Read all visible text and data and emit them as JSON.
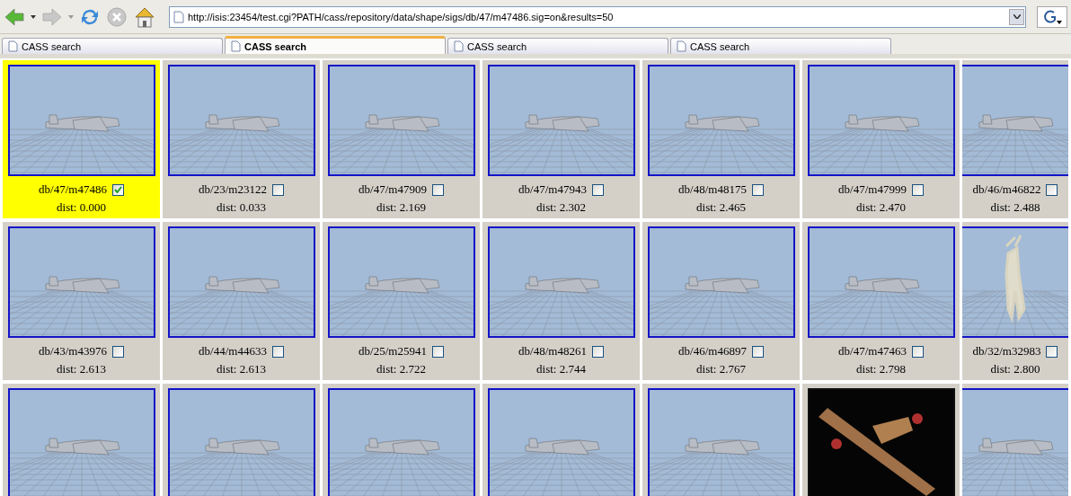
{
  "toolbar": {
    "url": "http://isis:23454/test.cgi?PATH/cass/repository/data/shape/sigs/db/47/m47486.sig=on&results=50"
  },
  "tabs": [
    {
      "label": "CASS search",
      "selected": false
    },
    {
      "label": "CASS search",
      "selected": true
    },
    {
      "label": "CASS search",
      "selected": false
    },
    {
      "label": "CASS search",
      "selected": false
    }
  ],
  "results": [
    {
      "kind": "plane",
      "name": "db/47/m47486",
      "checked": true,
      "selected": true,
      "dist": "dist: 0.000"
    },
    {
      "kind": "plane",
      "name": "db/23/m23122",
      "checked": false,
      "selected": false,
      "dist": "dist: 0.033"
    },
    {
      "kind": "plane",
      "name": "db/47/m47909",
      "checked": false,
      "selected": false,
      "dist": "dist: 2.169"
    },
    {
      "kind": "plane",
      "name": "db/47/m47943",
      "checked": false,
      "selected": false,
      "dist": "dist: 2.302"
    },
    {
      "kind": "plane",
      "name": "db/48/m48175",
      "checked": false,
      "selected": false,
      "dist": "dist: 2.465"
    },
    {
      "kind": "plane",
      "name": "db/47/m47999",
      "checked": false,
      "selected": false,
      "dist": "dist: 2.470"
    },
    {
      "kind": "plane",
      "name": "db/46/m46822",
      "checked": false,
      "selected": false,
      "dist": "dist: 2.488"
    },
    {
      "kind": "plane",
      "name": "db/43/m43976",
      "checked": false,
      "selected": false,
      "dist": "dist: 2.613"
    },
    {
      "kind": "plane",
      "name": "db/44/m44633",
      "checked": false,
      "selected": false,
      "dist": "dist: 2.613"
    },
    {
      "kind": "plane",
      "name": "db/25/m25941",
      "checked": false,
      "selected": false,
      "dist": "dist: 2.722"
    },
    {
      "kind": "plane",
      "name": "db/48/m48261",
      "checked": false,
      "selected": false,
      "dist": "dist: 2.744"
    },
    {
      "kind": "plane",
      "name": "db/46/m46897",
      "checked": false,
      "selected": false,
      "dist": "dist: 2.767"
    },
    {
      "kind": "plane",
      "name": "db/47/m47463",
      "checked": false,
      "selected": false,
      "dist": "dist: 2.798"
    },
    {
      "kind": "deer",
      "name": "db/32/m32983",
      "checked": false,
      "selected": false,
      "dist": "dist: 2.800"
    },
    {
      "kind": "plane",
      "selected": false
    },
    {
      "kind": "plane",
      "selected": false
    },
    {
      "kind": "plane",
      "selected": false
    },
    {
      "kind": "plane",
      "selected": false
    },
    {
      "kind": "plane",
      "selected": false
    },
    {
      "kind": "photo",
      "selected": false
    },
    {
      "kind": "plane",
      "selected": false
    }
  ]
}
